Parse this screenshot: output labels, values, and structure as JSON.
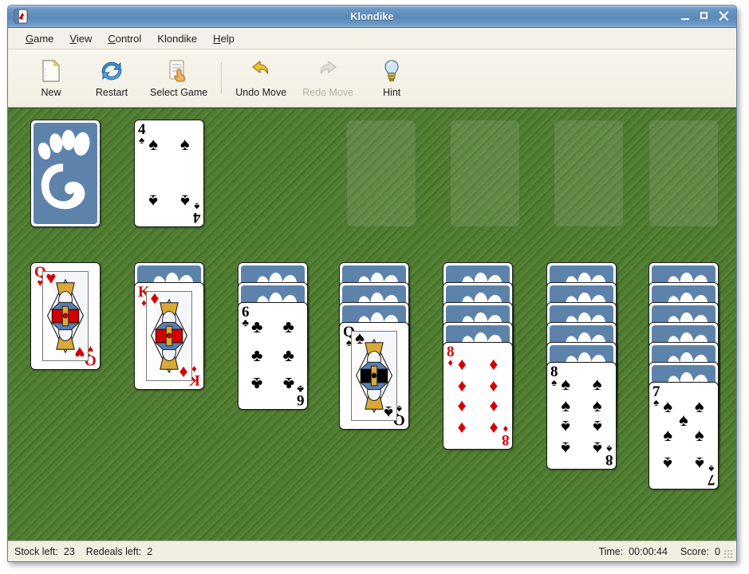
{
  "window": {
    "title": "Klondike",
    "icon": "playing-card-icon",
    "controls": {
      "minimize": "minimize",
      "maximize": "maximize",
      "close": "close"
    }
  },
  "menubar": {
    "items": [
      {
        "label": "Game",
        "mnemonic": "G"
      },
      {
        "label": "View",
        "mnemonic": "V"
      },
      {
        "label": "Control",
        "mnemonic": "C"
      },
      {
        "label": "Klondike",
        "mnemonic": ""
      },
      {
        "label": "Help",
        "mnemonic": "H"
      }
    ]
  },
  "toolbar": {
    "buttons": [
      {
        "label": "New",
        "icon": "new-document-icon",
        "enabled": true
      },
      {
        "label": "Restart",
        "icon": "refresh-icon",
        "enabled": true
      },
      {
        "label": "Select Game",
        "icon": "select-game-icon",
        "enabled": true
      },
      {
        "label": "Undo Move",
        "icon": "undo-arrow-icon",
        "enabled": true
      },
      {
        "label": "Redo Move",
        "icon": "redo-arrow-icon",
        "enabled": false
      },
      {
        "label": "Hint",
        "icon": "lightbulb-icon",
        "enabled": true
      }
    ]
  },
  "board": {
    "felt_color": "#4c7a2c",
    "card_back_color": "#5d83ab",
    "card_back_art": "gnome-foot-logo",
    "stock": {
      "name": "stock-pile",
      "face_down_visible": true,
      "cards_remaining": 23
    },
    "waste": {
      "name": "waste-pile",
      "top_card": {
        "rank": "4",
        "suit": "spades",
        "color": "black"
      }
    },
    "foundations": [
      {
        "name": "foundation-1",
        "empty": true
      },
      {
        "name": "foundation-2",
        "empty": true
      },
      {
        "name": "foundation-3",
        "empty": true
      },
      {
        "name": "foundation-4",
        "empty": true
      }
    ],
    "tableau": [
      {
        "name": "tableau-column-1",
        "face_down": 0,
        "face_up": [
          {
            "rank": "Q",
            "suit": "hearts",
            "color": "red",
            "court": true
          }
        ]
      },
      {
        "name": "tableau-column-2",
        "face_down": 1,
        "face_up": [
          {
            "rank": "K",
            "suit": "diamonds",
            "color": "red",
            "court": true
          }
        ]
      },
      {
        "name": "tableau-column-3",
        "face_down": 2,
        "face_up": [
          {
            "rank": "6",
            "suit": "clubs",
            "color": "black",
            "court": false
          }
        ]
      },
      {
        "name": "tableau-column-4",
        "face_down": 3,
        "face_up": [
          {
            "rank": "Q",
            "suit": "spades",
            "color": "black",
            "court": true
          }
        ]
      },
      {
        "name": "tableau-column-5",
        "face_down": 4,
        "face_up": [
          {
            "rank": "8",
            "suit": "diamonds",
            "color": "red",
            "court": false
          }
        ]
      },
      {
        "name": "tableau-column-6",
        "face_down": 5,
        "face_up": [
          {
            "rank": "8",
            "suit": "spades",
            "color": "black",
            "court": false
          }
        ]
      },
      {
        "name": "tableau-column-7",
        "face_down": 6,
        "face_up": [
          {
            "rank": "7",
            "suit": "spades",
            "color": "black",
            "court": false
          }
        ]
      }
    ]
  },
  "statusbar": {
    "stock_label": "Stock left:",
    "stock_value": "23",
    "redeals_label": "Redeals left:",
    "redeals_value": "2",
    "time_label": "Time:",
    "time_value": "00:00:44",
    "score_label": "Score:",
    "score_value": "0"
  }
}
